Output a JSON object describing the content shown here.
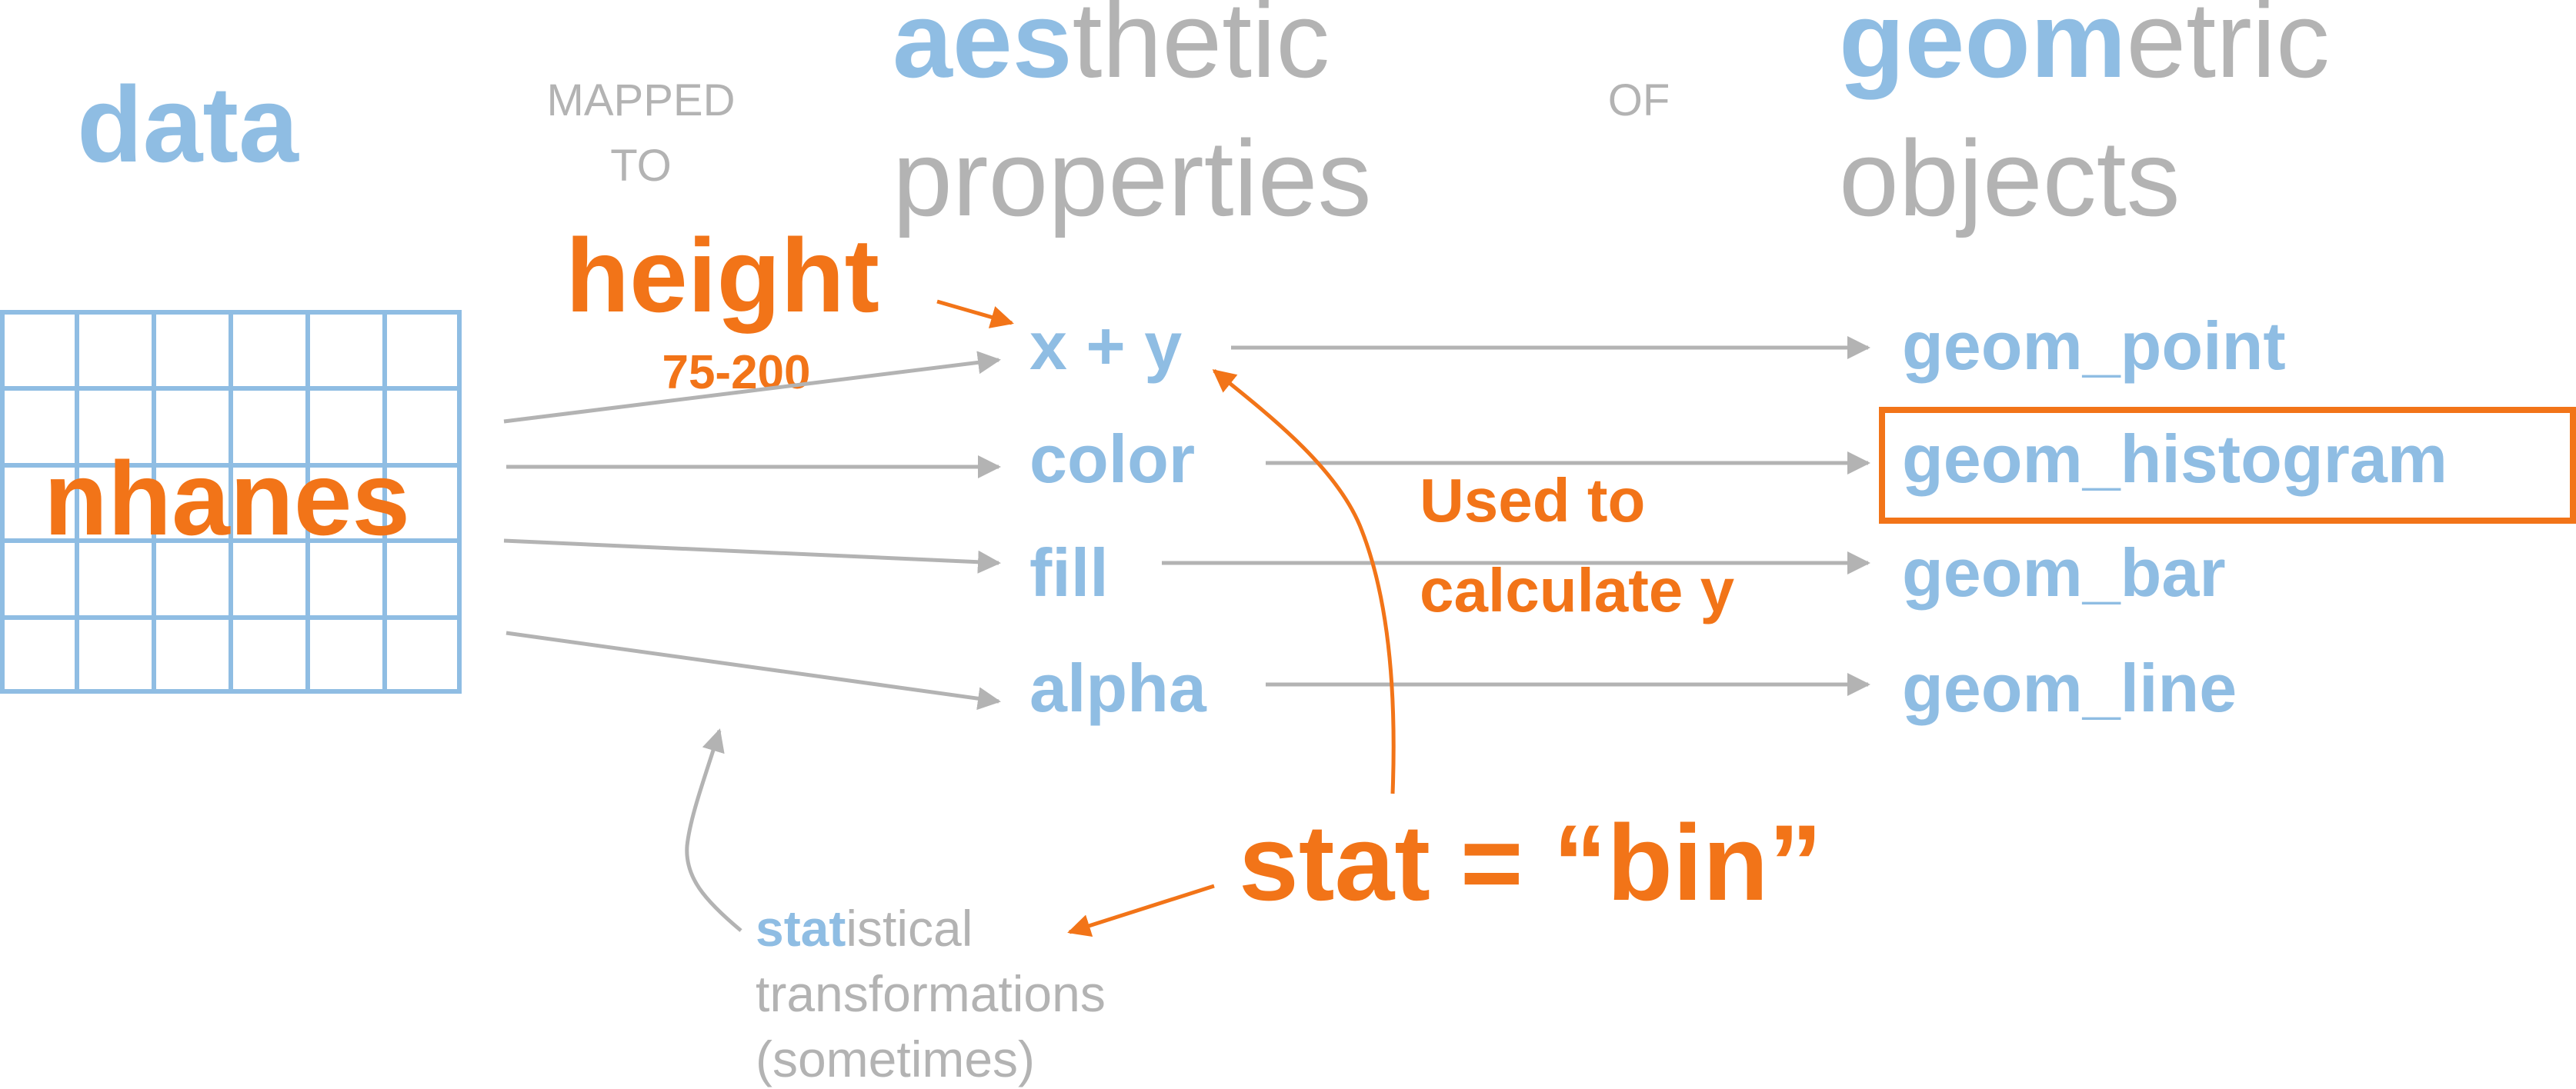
{
  "header": {
    "data": "data",
    "mapped_to_line1": "MAPPED",
    "mapped_to_line2": "TO",
    "aesthetic_highlight": "aes",
    "aesthetic_rest": "thetic",
    "properties": "properties",
    "of": "OF",
    "geometric_highlight": "geom",
    "geometric_rest": "etric",
    "objects": "objects"
  },
  "dataset": {
    "name": "nhanes"
  },
  "variable": {
    "name": "height",
    "range": "75-200"
  },
  "aesthetics": [
    "x + y",
    "color",
    "fill",
    "alpha"
  ],
  "geoms": [
    "geom_point",
    "geom_histogram",
    "geom_bar",
    "geom_line"
  ],
  "highlighted_geom": "geom_histogram",
  "annotation": {
    "line1": "Used to",
    "line2": "calculate y"
  },
  "stat": {
    "label": "stat = “bin”",
    "highlight": "stat",
    "rest": "istical",
    "line2": "transformations",
    "line3": "(sometimes)"
  },
  "colors": {
    "blue": "#8fbde3",
    "gray": "#b3b3b3",
    "orange": "#f27418"
  }
}
